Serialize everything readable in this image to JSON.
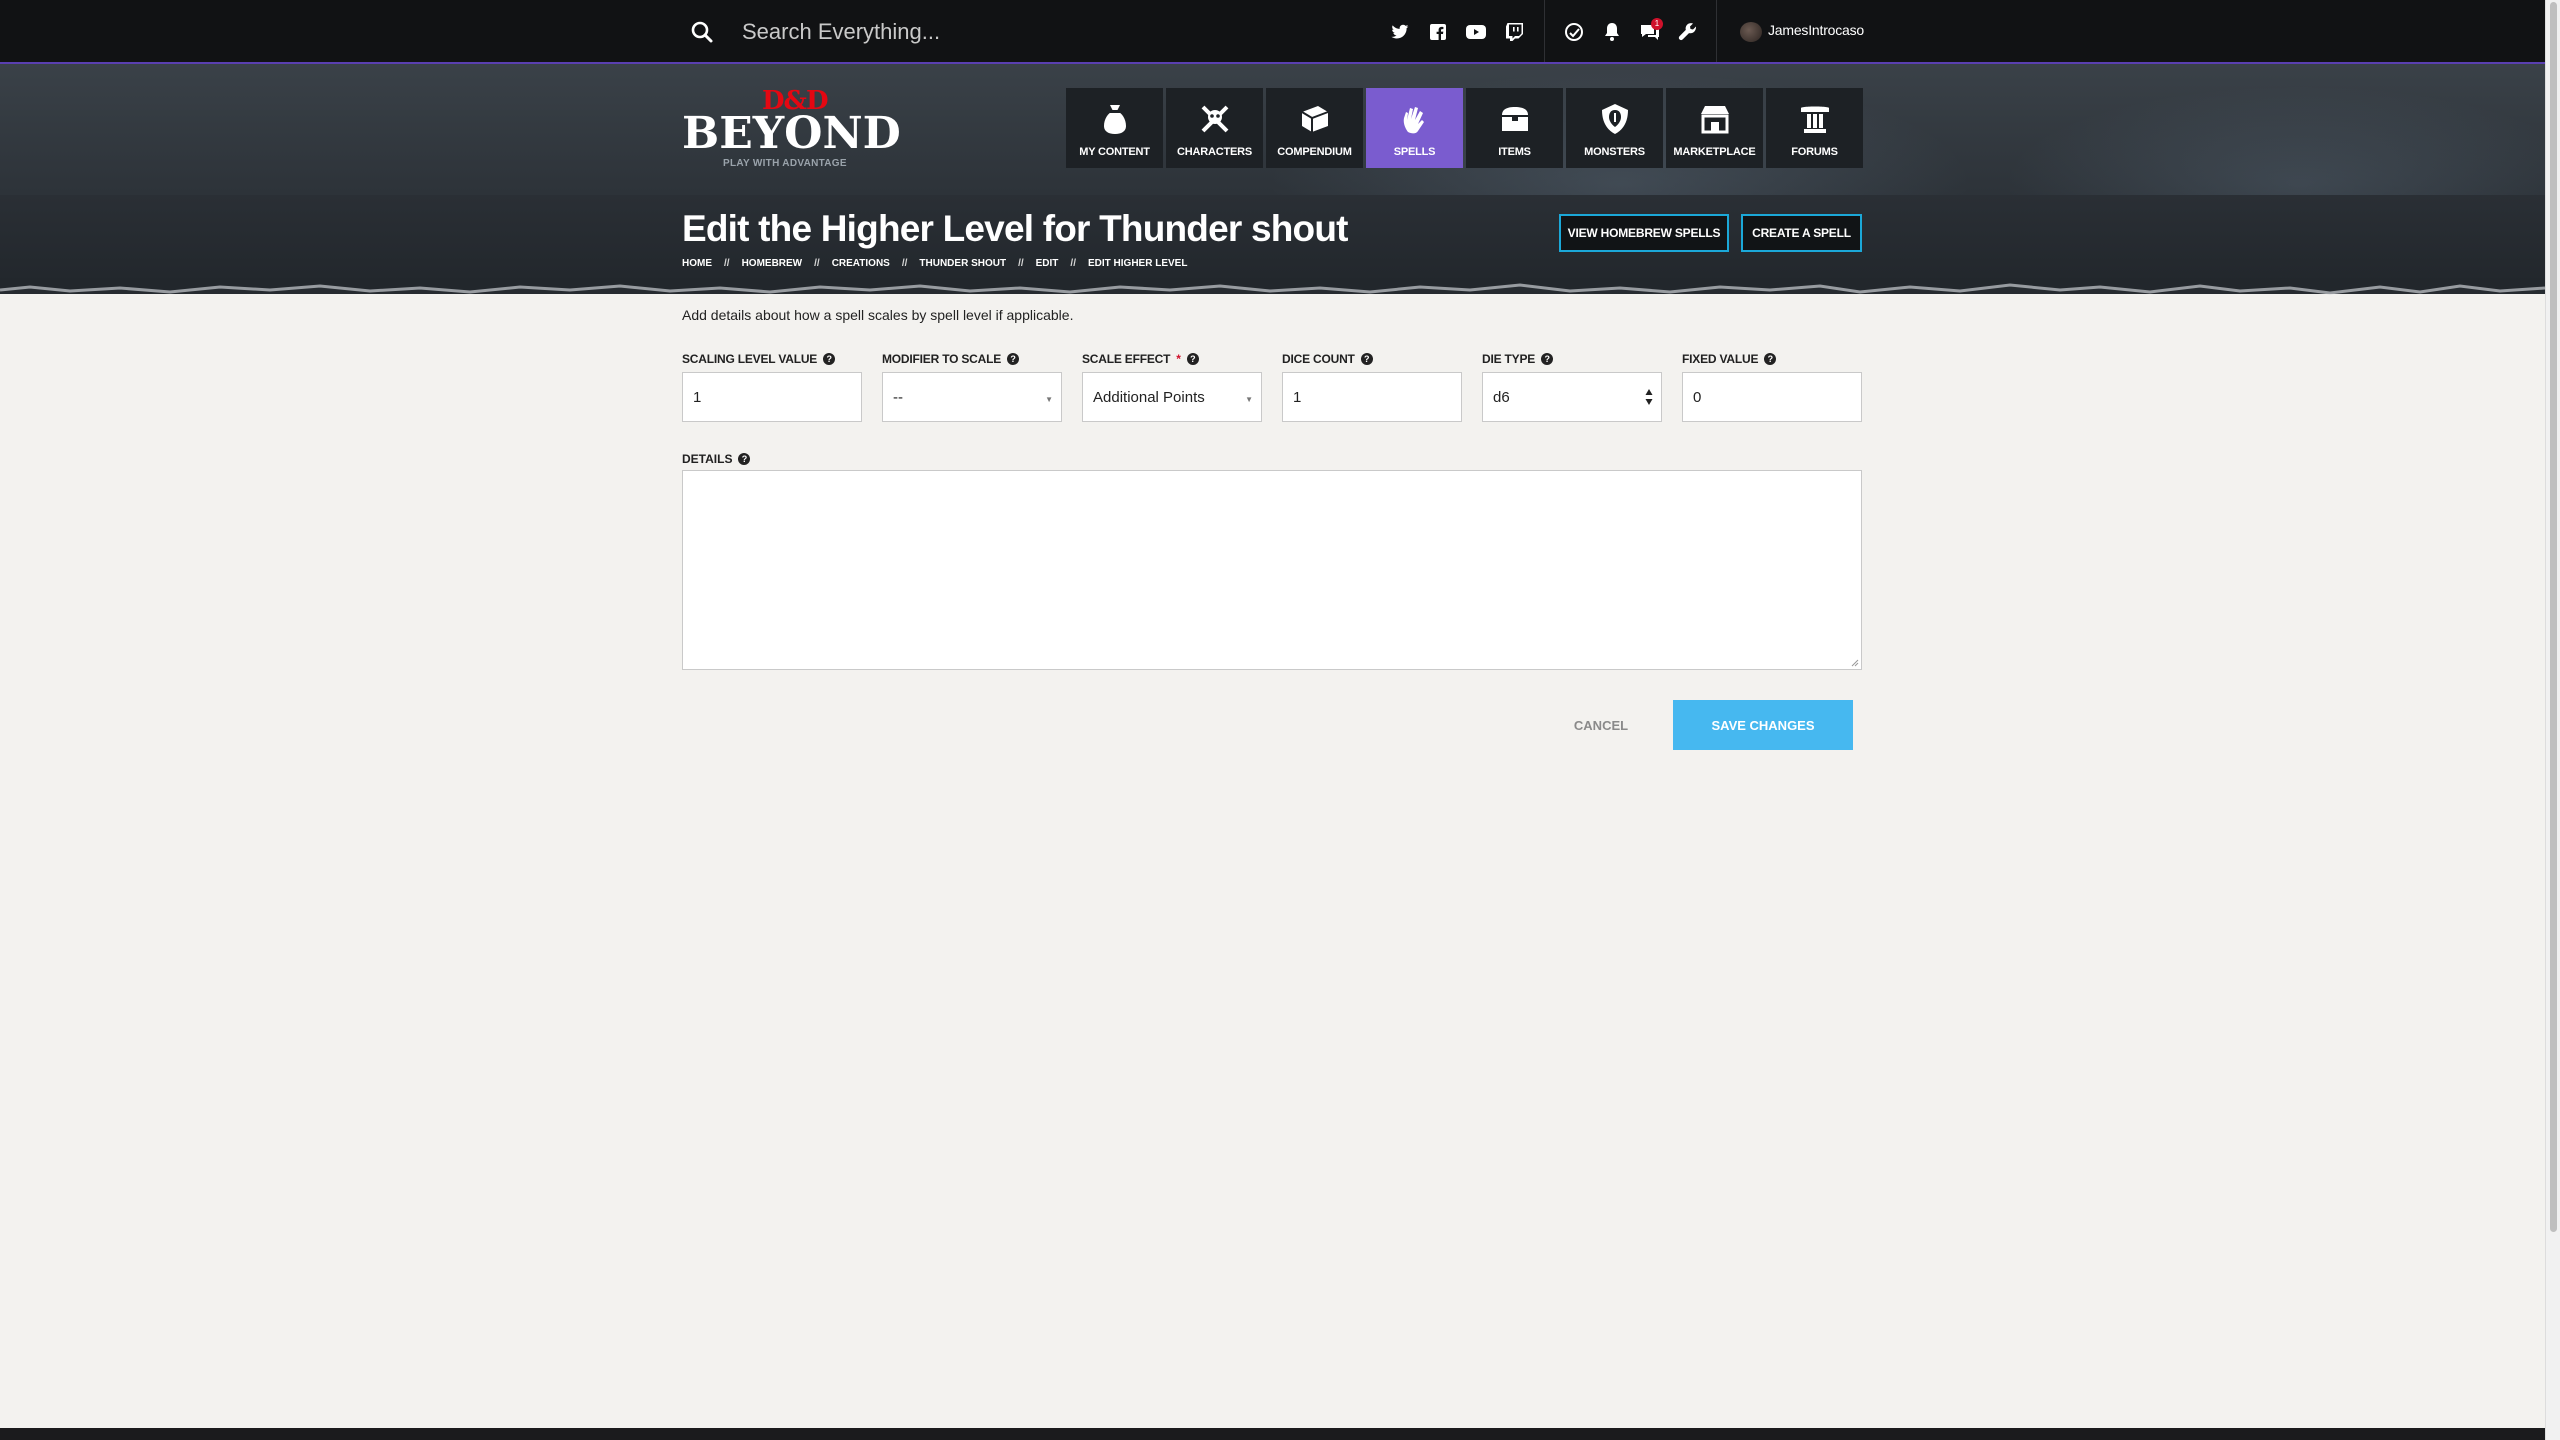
{
  "topbar": {
    "search_placeholder": "Search Everything...",
    "social": [
      "twitter-icon",
      "facebook-icon",
      "youtube-icon",
      "twitch-icon"
    ],
    "tools": [
      "dice-icon",
      "bell-icon",
      "chat-icon",
      "wrench-icon"
    ],
    "notification_count": "1",
    "username": "JamesIntrocaso"
  },
  "logo": {
    "brand_top": "D&D",
    "brand_main": "BEYOND",
    "tagline": "PLAY WITH ADVANTAGE"
  },
  "nav": {
    "items": [
      {
        "label": "MY CONTENT",
        "icon": "bag-icon"
      },
      {
        "label": "CHARACTERS",
        "icon": "crossed-swords-icon"
      },
      {
        "label": "COMPENDIUM",
        "icon": "book-icon"
      },
      {
        "label": "SPELLS",
        "icon": "hand-spell-icon"
      },
      {
        "label": "ITEMS",
        "icon": "chest-icon"
      },
      {
        "label": "MONSTERS",
        "icon": "monster-shield-icon"
      },
      {
        "label": "MARKETPLACE",
        "icon": "store-icon"
      },
      {
        "label": "FORUMS",
        "icon": "pillar-icon"
      }
    ],
    "active": "SPELLS"
  },
  "page": {
    "title": "Edit the Higher Level for Thunder shout",
    "breadcrumb": [
      "HOME",
      "HOMEBREW",
      "CREATIONS",
      "THUNDER SHOUT",
      "EDIT",
      "EDIT HIGHER LEVEL"
    ],
    "breadcrumb_separator": "//",
    "view_homebrew_label": "VIEW HOMEBREW SPELLS",
    "create_spell_label": "CREATE A SPELL"
  },
  "form": {
    "intro": "Add details about how a spell scales by spell level if applicable.",
    "scaling_level": {
      "label": "SCALING LEVEL VALUE",
      "value": "1"
    },
    "modifier": {
      "label": "MODIFIER TO SCALE",
      "value": "--"
    },
    "scale_effect": {
      "label": "SCALE EFFECT",
      "required_mark": "*",
      "value": "Additional Points"
    },
    "dice_count": {
      "label": "DICE COUNT",
      "value": "1"
    },
    "die_type": {
      "label": "DIE TYPE",
      "value": "d6"
    },
    "fixed_value": {
      "label": "FIXED VALUE",
      "value": "0"
    },
    "details": {
      "label": "DETAILS",
      "value": ""
    },
    "cancel_label": "CANCEL",
    "save_label": "SAVE CHANGES"
  },
  "colors": {
    "accent_purple": "#7a5ccf",
    "save_blue": "#46b8f0",
    "outline_blue": "#1ba8d8",
    "brand_red": "#e40712"
  }
}
